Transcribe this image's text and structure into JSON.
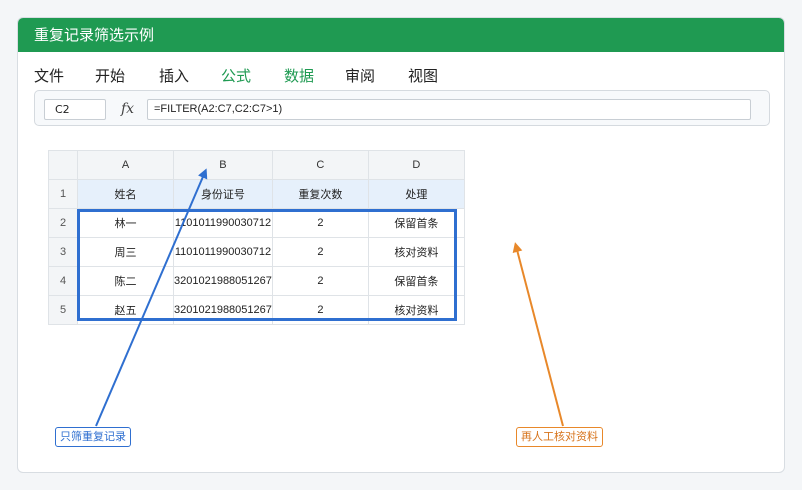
{
  "window": {
    "title": "重复记录筛选示例"
  },
  "menu": {
    "items": [
      {
        "label": "文件"
      },
      {
        "label": "开始"
      },
      {
        "label": "插入"
      },
      {
        "label": "公式"
      },
      {
        "label": "数据"
      },
      {
        "label": "审阅"
      },
      {
        "label": "视图"
      }
    ],
    "highlight_color": "#1f9a52"
  },
  "formula_bar": {
    "cell_ref": "C2",
    "fx_label": "fx",
    "formula": "=FILTER(A2:C7,C2:C7>1)"
  },
  "sheet": {
    "columns": [
      "A",
      "B",
      "C",
      "D"
    ],
    "rows": [
      {
        "num": "1",
        "cells": [
          "姓名",
          "身份证号",
          "重复次数",
          "处理"
        ]
      },
      {
        "num": "2",
        "cells": [
          "林一",
          "110101199003071​2",
          "2",
          "保留首条"
        ]
      },
      {
        "num": "3",
        "cells": [
          "周三",
          "1101011990030712",
          "2",
          "核对资料"
        ]
      },
      {
        "num": "4",
        "cells": [
          "陈二",
          "3201021988051267",
          "2",
          "保留首条"
        ]
      },
      {
        "num": "5",
        "cells": [
          "赵五",
          "3201021988051267",
          "2",
          "核对资料"
        ]
      }
    ],
    "header_fill": "#e6f0fb",
    "selection_color": "#2f6fd0"
  },
  "annotations": {
    "left": {
      "text": "只筛重复记录",
      "color": "#2f6fd0"
    },
    "right": {
      "text": "再人工核对资料",
      "color": "#e8882a"
    }
  }
}
